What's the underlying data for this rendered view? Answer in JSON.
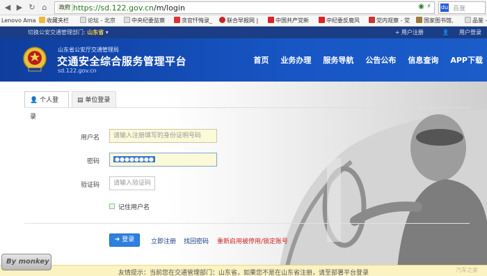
{
  "browser": {
    "address_label": "政府",
    "url_host": "https://sd.122.gov.cn",
    "url_path": "/m/login",
    "search_placeholder": "百度",
    "bookmarks": [
      "Lenovo Ama",
      "收藏夹栏",
      "论坛 - 北京",
      "中央纪委监察",
      "贪官忏悔录_",
      "联合早报网 |",
      "中国共产党新",
      "中纪委反腐风",
      "党内观察 - 党",
      "国家图书馆,",
      "品鉴 -"
    ]
  },
  "topbar": {
    "region_prefix": "切换公安交通管理部门:",
    "region_value": "山东省",
    "register_link": "+ 用户注册",
    "login_link": "用户登录"
  },
  "header": {
    "sub_title": "山东省公安厅交通管理局",
    "title": "交通安全综合服务管理平台",
    "domain": "sd.122.gov.cn",
    "nav": [
      "首页",
      "业务办理",
      "服务导航",
      "公告公布",
      "信息查询",
      "APP下载"
    ]
  },
  "tabs": {
    "personal": "个人登录",
    "company": "单位登录"
  },
  "form": {
    "username_label": "用户名",
    "username_placeholder": "请输入注册填写的身份证明号码",
    "password_label": "密码",
    "password_value": "●●●●●●●●",
    "captcha_label": "验证码",
    "captcha_placeholder": "请输入验证码",
    "remember_label": "记住用户名"
  },
  "actions": {
    "login": "登录",
    "register": "立即注册",
    "recover": "找回密码",
    "reactivate": "重新启用被停用/锁定账号"
  },
  "notice": "友情提示：当前您在交通管理部门：山东省，如果您不是在山东省注册，请至部署平台登录",
  "watermarks": {
    "left": "By monkey",
    "right": "汽车之家"
  }
}
